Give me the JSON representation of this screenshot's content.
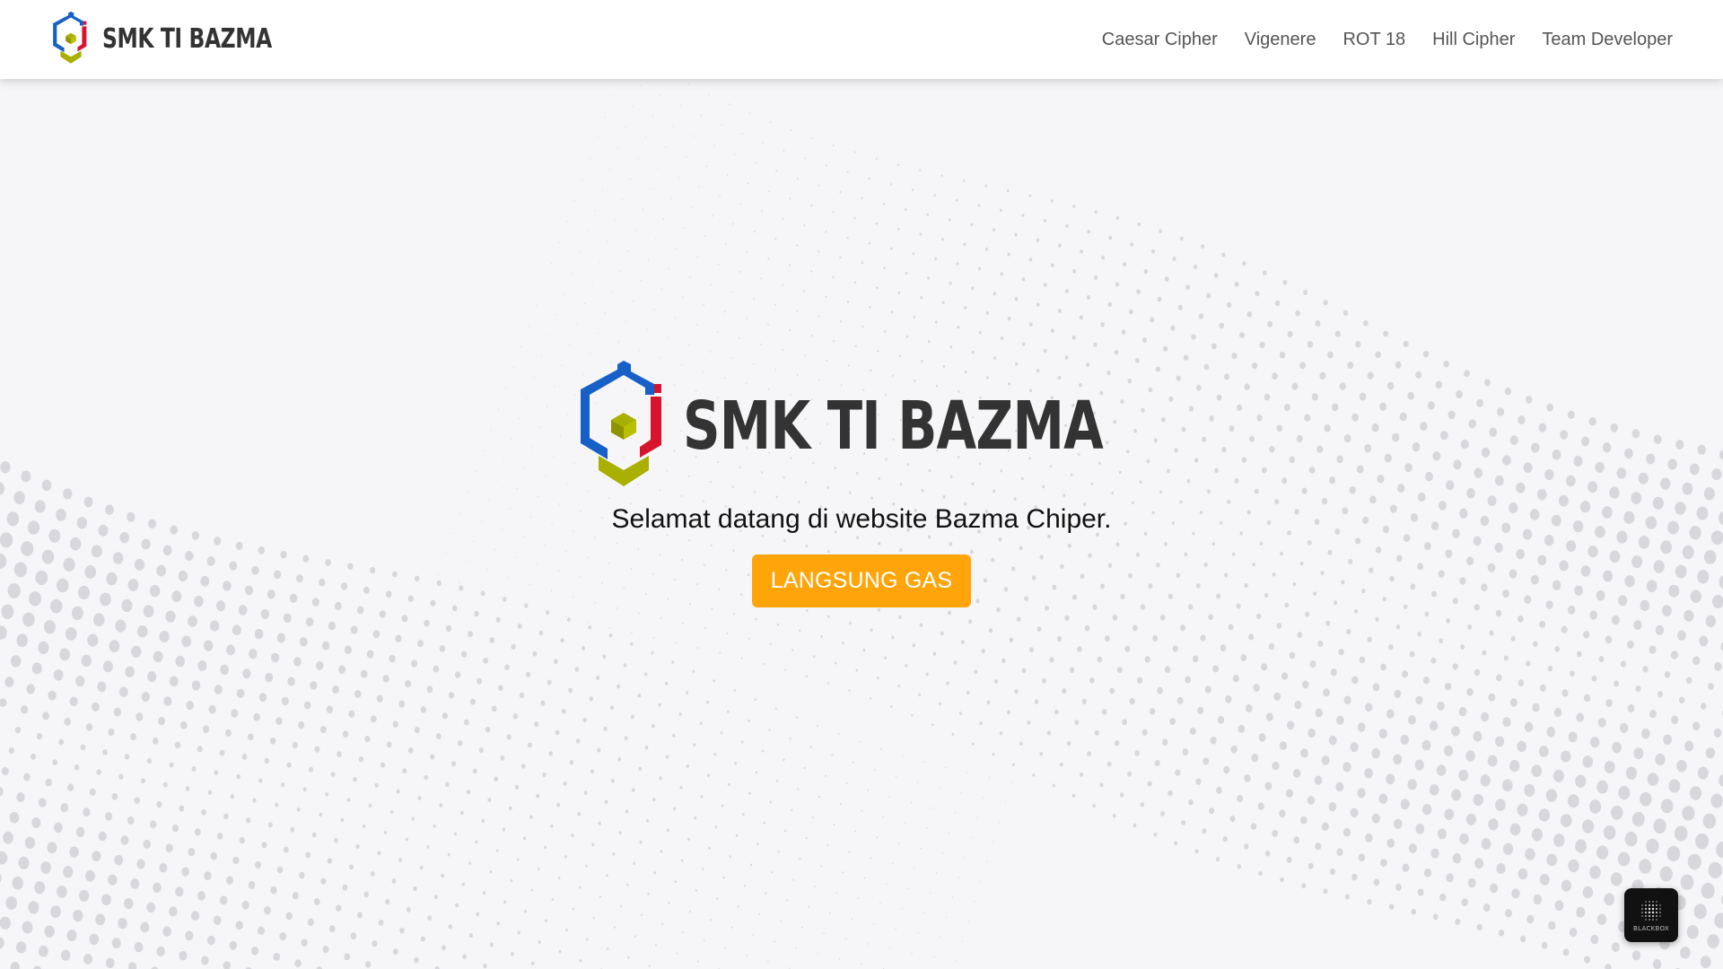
{
  "navbar": {
    "brand_text": "SMK TI BAZMA",
    "links": [
      {
        "label": "Caesar Cipher"
      },
      {
        "label": "Vigenere"
      },
      {
        "label": "ROT 18"
      },
      {
        "label": "Hill Cipher"
      },
      {
        "label": "Team Developer"
      }
    ]
  },
  "hero": {
    "logo_text": "SMK TI BAZMA",
    "welcome_text": "Selamat datang di website Bazma Chiper.",
    "cta_label": "LANGSUNG GAS"
  },
  "widget": {
    "label": "BLACKBOX",
    "icon": "blackbox-logo-icon"
  },
  "colors": {
    "logo_blue": "#1760c8",
    "logo_red": "#d7142d",
    "logo_olive": "#a9b000",
    "cta_orange": "#ffa50a",
    "background": "#f6f6f8"
  }
}
